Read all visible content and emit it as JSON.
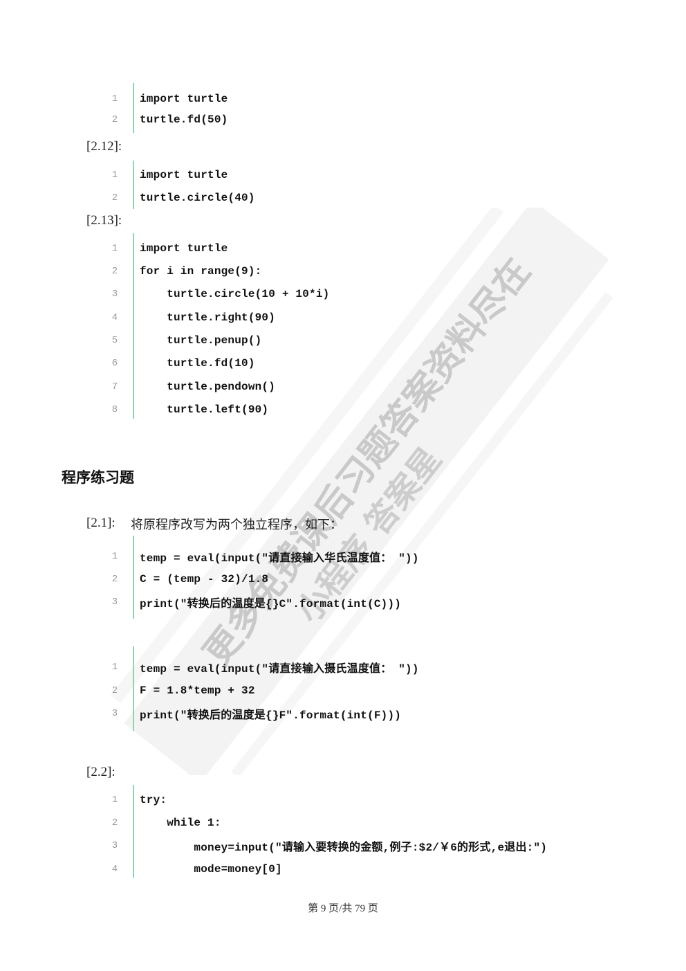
{
  "blocks": {
    "b0": {
      "lines": [
        {
          "n": "1",
          "code": "import turtle"
        },
        {
          "n": "2",
          "code": "turtle.fd(50)"
        }
      ]
    },
    "b1": {
      "label": "[2.12]:",
      "lines": [
        {
          "n": "1",
          "code": "import turtle"
        },
        {
          "n": "2",
          "code": "turtle.circle(40)"
        }
      ]
    },
    "b2": {
      "label": "[2.13]:",
      "lines": [
        {
          "n": "1",
          "code": "import turtle"
        },
        {
          "n": "2",
          "code": "for i in range(9):"
        },
        {
          "n": "3",
          "code": "    turtle.circle(10 + 10*i)"
        },
        {
          "n": "4",
          "code": "    turtle.right(90)"
        },
        {
          "n": "5",
          "code": "    turtle.penup()"
        },
        {
          "n": "6",
          "code": "    turtle.fd(10)"
        },
        {
          "n": "7",
          "code": "    turtle.pendown()"
        },
        {
          "n": "8",
          "code": "    turtle.left(90)"
        }
      ]
    }
  },
  "section_heading": "程序练习题",
  "exercise_2_1": {
    "label": "[2.1]:",
    "description": "将原程序改写为两个独立程序，如下：",
    "program_a": [
      {
        "n": "1",
        "code": "temp = eval(input(\"请直接输入华氏温度值： \"))"
      },
      {
        "n": "2",
        "code": "C = (temp - 32)/1.8"
      },
      {
        "n": "3",
        "code": "print(\"转换后的温度是{}C\".format(int(C)))"
      }
    ],
    "program_b": [
      {
        "n": "1",
        "code": "temp = eval(input(\"请直接输入摄氏温度值： \"))"
      },
      {
        "n": "2",
        "code": "F = 1.8*temp + 32"
      },
      {
        "n": "3",
        "code": "print(\"转换后的温度是{}F\".format(int(F)))"
      }
    ]
  },
  "exercise_2_2": {
    "label": "[2.2]:",
    "lines": [
      {
        "n": "1",
        "code": "try:"
      },
      {
        "n": "2",
        "code": "    while 1:"
      },
      {
        "n": "3",
        "code": "        money=input(\"请输入要转换的金额,例子:$2/￥6的形式,e退出:\")"
      },
      {
        "n": "4",
        "code": "        mode=money[0]"
      }
    ]
  },
  "watermark_text": [
    "更多免费课后习题答案资料尽在",
    "小程序 答案星"
  ],
  "footer": "第 9 页/共 79 页"
}
